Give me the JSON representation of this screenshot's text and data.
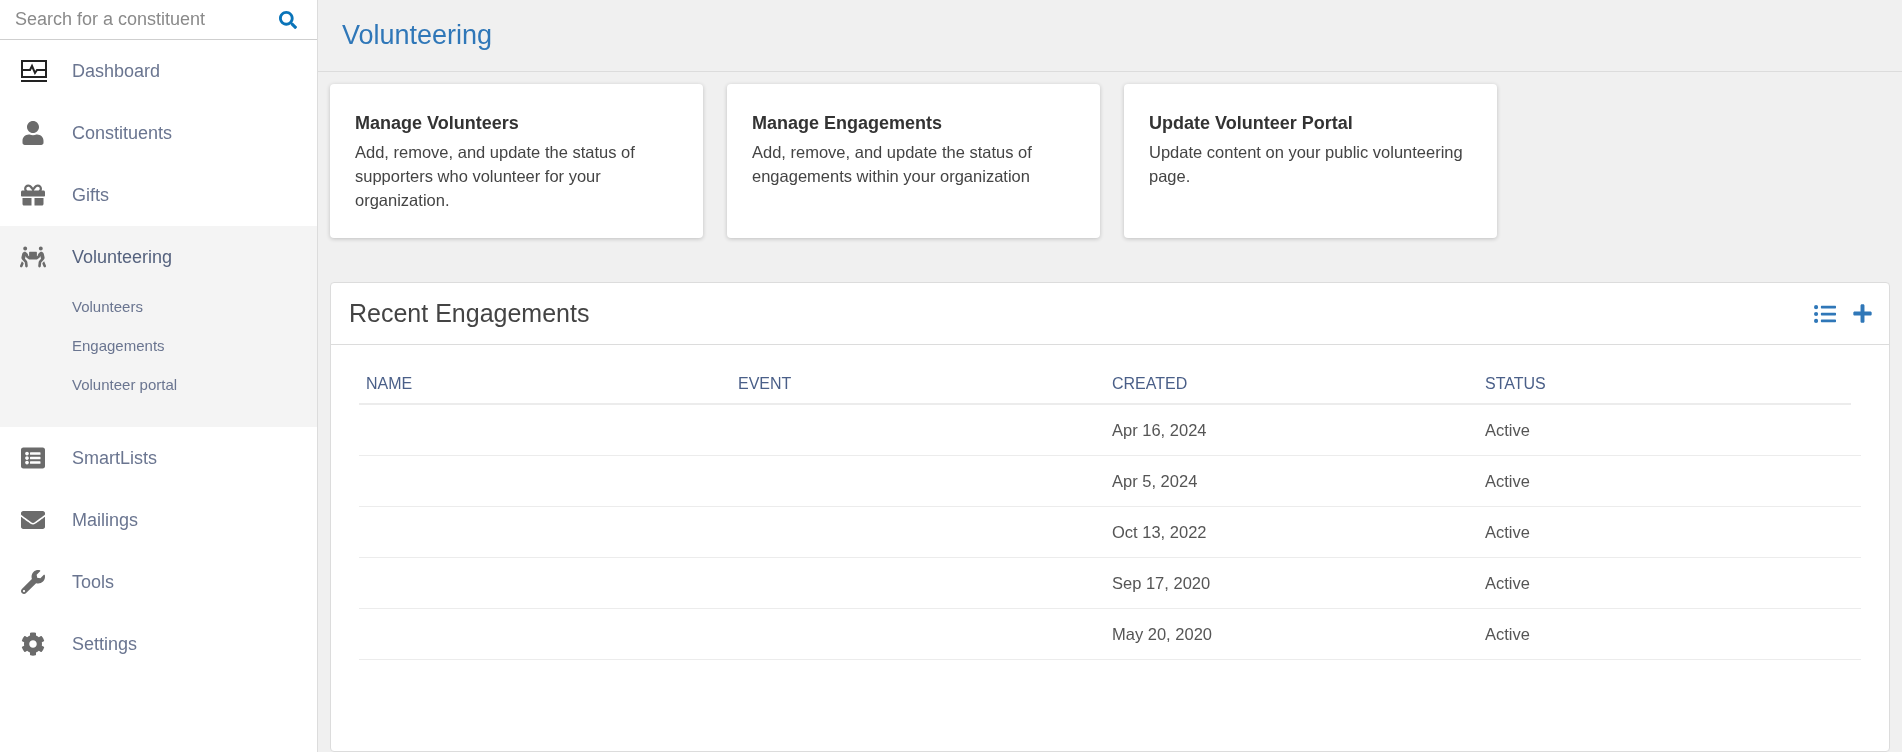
{
  "search": {
    "placeholder": "Search for a constituent"
  },
  "sidebar": {
    "items": [
      {
        "label": "Dashboard",
        "selected": false
      },
      {
        "label": "Constituents",
        "selected": false
      },
      {
        "label": "Gifts",
        "selected": false
      },
      {
        "label": "Volunteering",
        "selected": true,
        "children": [
          {
            "label": "Volunteers"
          },
          {
            "label": "Engagements"
          },
          {
            "label": "Volunteer portal"
          }
        ]
      },
      {
        "label": "SmartLists",
        "selected": false
      },
      {
        "label": "Mailings",
        "selected": false
      },
      {
        "label": "Tools",
        "selected": false
      },
      {
        "label": "Settings",
        "selected": false
      }
    ]
  },
  "page_title": "Volunteering",
  "cards": [
    {
      "title": "Manage Volunteers",
      "description": "Add, remove, and update the status of supporters who volunteer for your organization."
    },
    {
      "title": "Manage Engagements",
      "description": "Add, remove, and update the status of engagements within your organization"
    },
    {
      "title": "Update Volunteer Portal",
      "description": "Update content on your public volunteering page."
    }
  ],
  "recent": {
    "title": "Recent Engagements",
    "columns": [
      "NAME",
      "EVENT",
      "CREATED",
      "STATUS"
    ],
    "rows": [
      {
        "created": "Apr 16, 2024",
        "status": "Active"
      },
      {
        "created": "Apr 5, 2024",
        "status": "Active"
      },
      {
        "created": "Oct 13, 2022",
        "status": "Active"
      },
      {
        "created": "Sep 17, 2020",
        "status": "Active"
      },
      {
        "created": "May 20, 2020",
        "status": "Active"
      }
    ]
  }
}
